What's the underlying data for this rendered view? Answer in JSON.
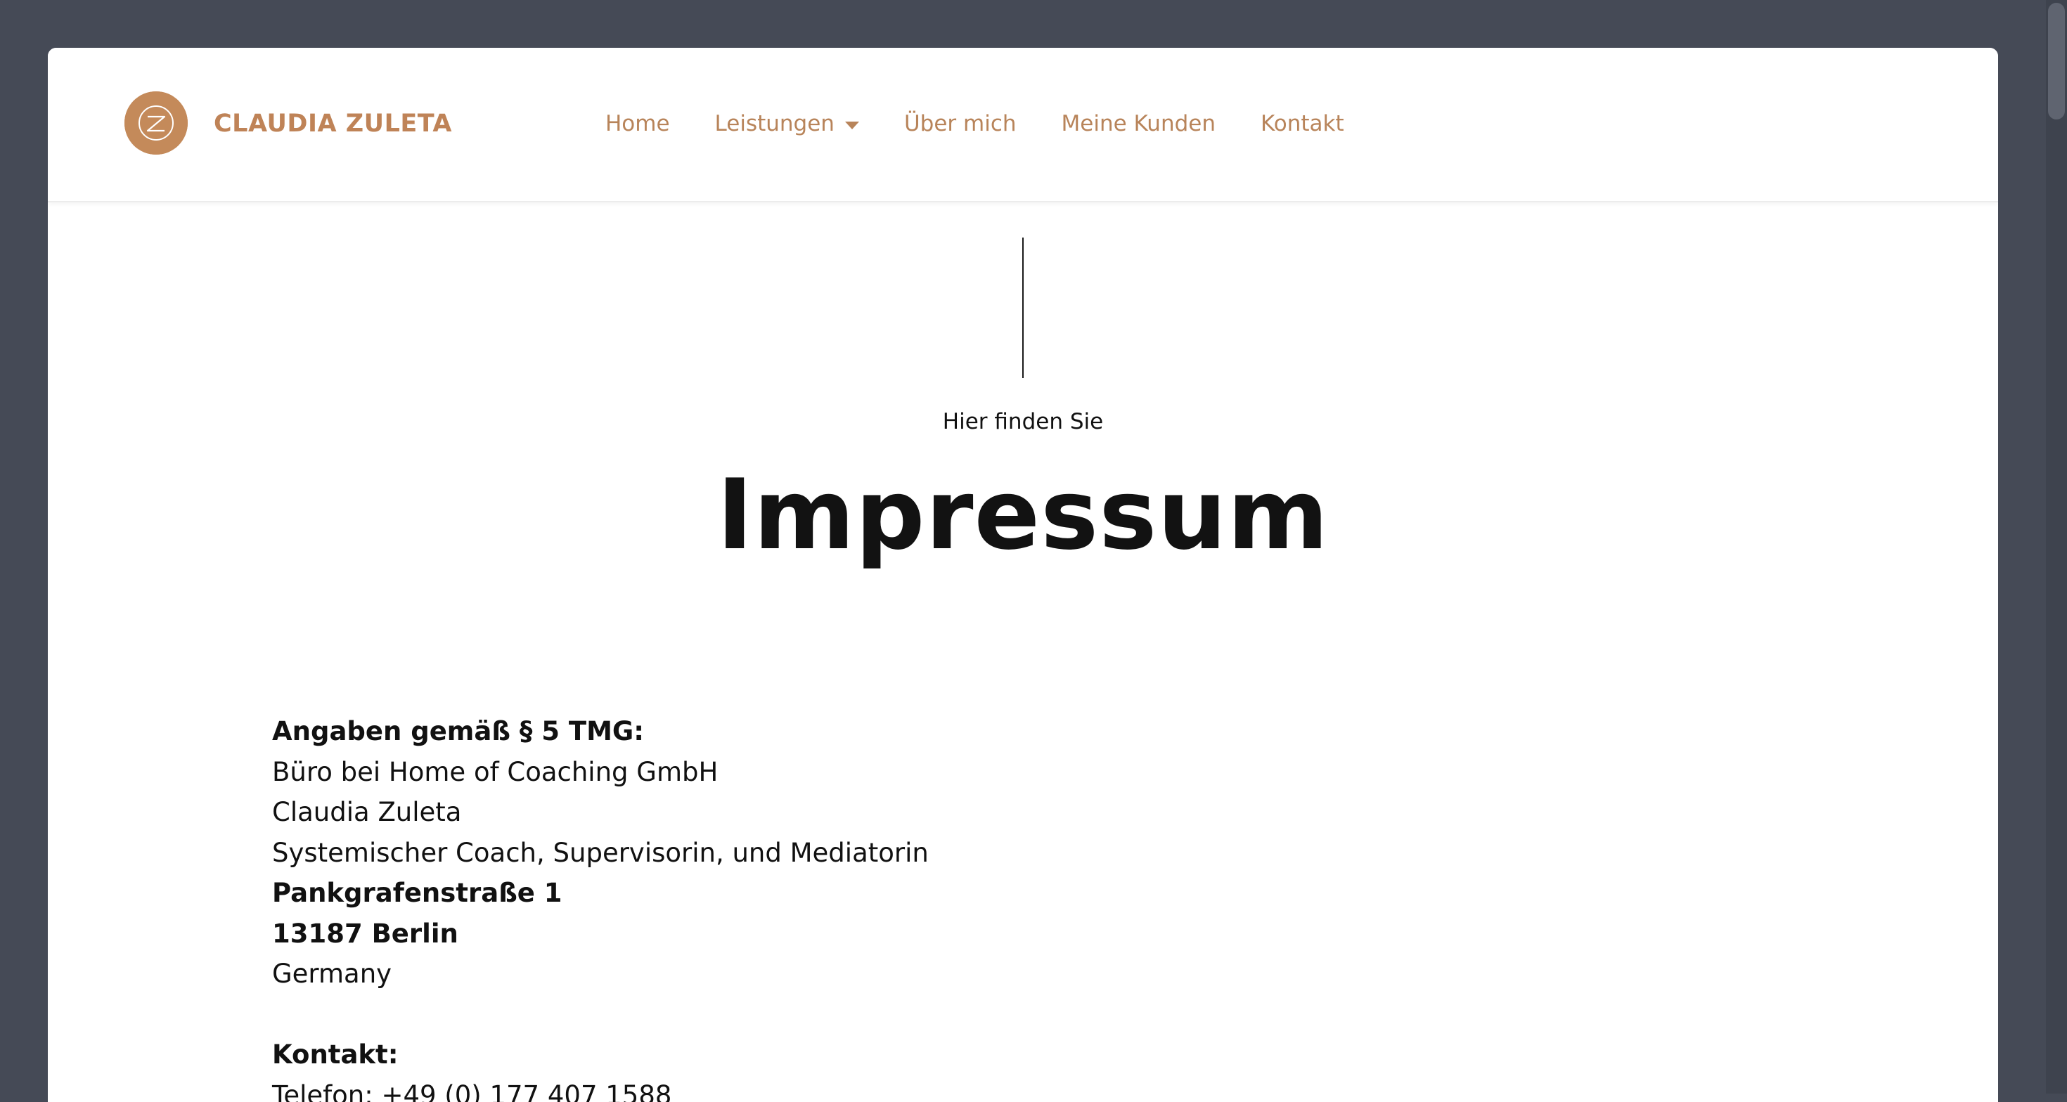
{
  "brand": {
    "name": "CLAUDIA ZULETA",
    "logo_icon": "cz-monogram-icon",
    "accent_color": "#c48a5a"
  },
  "nav": {
    "items": [
      {
        "label": "Home"
      },
      {
        "label": "Leistungen",
        "has_dropdown": true
      },
      {
        "label": "Über mich"
      },
      {
        "label": "Meine Kunden"
      },
      {
        "label": "Kontakt"
      }
    ]
  },
  "hero": {
    "eyebrow": "Hier finden Sie",
    "title": "Impressum"
  },
  "impressum": {
    "section_heading": "Angaben gemäß § 5 TMG:",
    "office": "Büro bei Home of Coaching GmbH",
    "name": "Claudia Zuleta",
    "profession": "Systemischer Coach, Supervisorin, und Mediatorin",
    "street": "Pankgrafenstraße 1",
    "city": "13187 Berlin",
    "country": "Germany",
    "contact_heading": "Kontakt:",
    "phone": "Telefon: +49 (0) 177 407 1588"
  }
}
